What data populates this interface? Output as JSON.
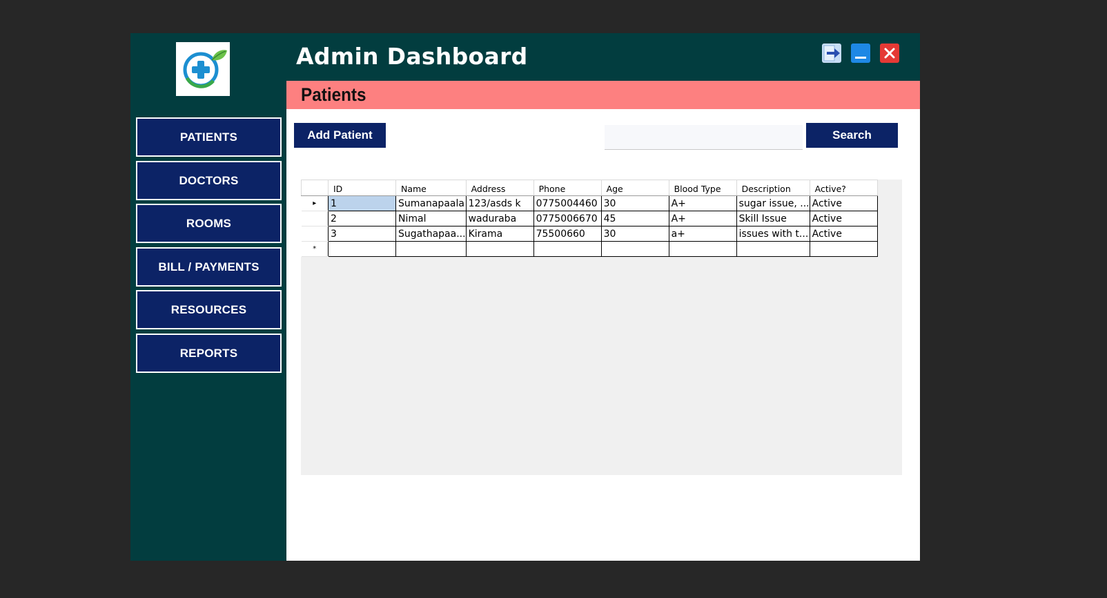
{
  "app": {
    "title": "Admin Dashboard"
  },
  "titlebar": {
    "icons": [
      "logout-icon",
      "minimize-icon",
      "close-icon"
    ],
    "colors": {
      "logout": "#c7ddf5",
      "minimize": "#1e88e5",
      "close": "#e53935"
    }
  },
  "sidebar": {
    "items": [
      {
        "label": "PATIENTS"
      },
      {
        "label": "DOCTORS"
      },
      {
        "label": "ROOMS"
      },
      {
        "label": "BILL / PAYMENTS"
      },
      {
        "label": "RESOURCES"
      },
      {
        "label": "REPORTS"
      }
    ]
  },
  "section": {
    "title": "Patients"
  },
  "toolbar": {
    "add_label": "Add Patient",
    "search_label": "Search",
    "search_value": "",
    "search_placeholder": ""
  },
  "table": {
    "columns": [
      "ID",
      "Name",
      "Address",
      "Phone",
      "Age",
      "Blood Type",
      "Description",
      "Active?"
    ],
    "rows": [
      [
        "1",
        "Sumanapaala",
        "123/asds k",
        "0775004460",
        "30",
        "A+",
        "sugar issue, ...",
        "Active"
      ],
      [
        "2",
        "Nimal",
        "waduraba",
        "0775006670",
        "45",
        "A+",
        "Skill Issue",
        "Active"
      ],
      [
        "3",
        "Sugathapaa...",
        "Kirama",
        "75500660",
        "30",
        "a+",
        "issues with t...",
        "Active"
      ]
    ],
    "row_markers": [
      "▸",
      "",
      "",
      "*"
    ]
  },
  "colors": {
    "sidebar_bg": "#023d3f",
    "button_bg": "#0c2366",
    "section_bar": "#fd8080",
    "page_bg": "#272727"
  }
}
